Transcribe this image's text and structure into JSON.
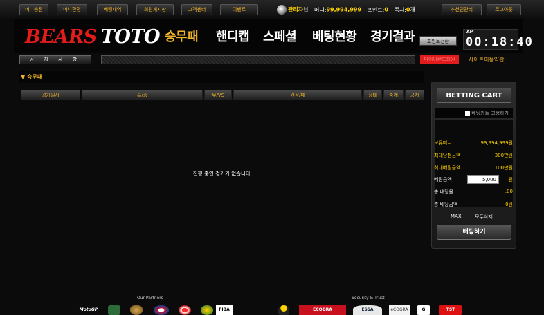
{
  "topbar": {
    "buttons": [
      "머니충전",
      "머니환전",
      "베팅내역",
      "회원게시판",
      "고객센터",
      "이벤트"
    ],
    "right_buttons": [
      "추천인관리",
      "로그아웃"
    ],
    "user": {
      "name": "관리자",
      "suffix": "님",
      "money_label": "머니:",
      "money": "99,994,999",
      "points_label": "포인트:",
      "points": "0",
      "messages_label": "쪽지:",
      "messages": "0",
      "messages_unit": "개"
    }
  },
  "header": {
    "brand_red": "BEARS",
    "brand_white": "TOTO",
    "nav": [
      "승무패",
      "핸디캡",
      "스페셜",
      "베팅현황",
      "경기결과"
    ],
    "active_nav": "승무패",
    "convert_button": "포인트전환",
    "clock": {
      "ampm": "AM",
      "time": "00:18:40"
    }
  },
  "notice": {
    "label": "공 지 사 항",
    "red_label": "다이아몬드회원",
    "terms_link": "사이트이용약관"
  },
  "main": {
    "section_title": "▼ 승무패",
    "columns": [
      "경기일시",
      "홈/승",
      "무/VS",
      "원정/패",
      "상태",
      "중계",
      "공지"
    ],
    "empty_message": "진행 중인 경기가 없습니다."
  },
  "cart": {
    "title": "BETTING CART",
    "fix_label": "베팅카트 고정하기",
    "balance_label": "보유머니",
    "balance_value": "99,994,999원",
    "max_win_label": "최대당첨금액",
    "max_win_value": "300만원",
    "max_bet_label": "최대베팅금액",
    "max_bet_value": "100만원",
    "bet_amount_label": "베팅금액",
    "bet_amount_value": "5,000",
    "bet_amount_unit": "원",
    "total_odds_label": "총 배당율",
    "total_odds_value": ".00",
    "total_payout_label": "총 배당금액",
    "total_payout_value": "0원",
    "max_button": "MAX",
    "clear_button": "모두삭제",
    "submit_button": "배팅하기"
  },
  "footer": {
    "partners_label": "Our Partners",
    "security_label": "Security & Trust",
    "partner_logos": [
      "motogp-icon",
      "club-badge-icon",
      "crest-icon",
      "bayern-icon",
      "benfica-icon",
      "fiba-icon"
    ],
    "security_logos": [
      "mascot-icon",
      "ecogra-icon",
      "essa-icon",
      "ecogra-seal-icon",
      "gc-icon",
      "tst-icon"
    ]
  },
  "colors": {
    "accent": "#f0b428",
    "brand_red": "#e21b1b",
    "background": "#0b0b0b"
  }
}
